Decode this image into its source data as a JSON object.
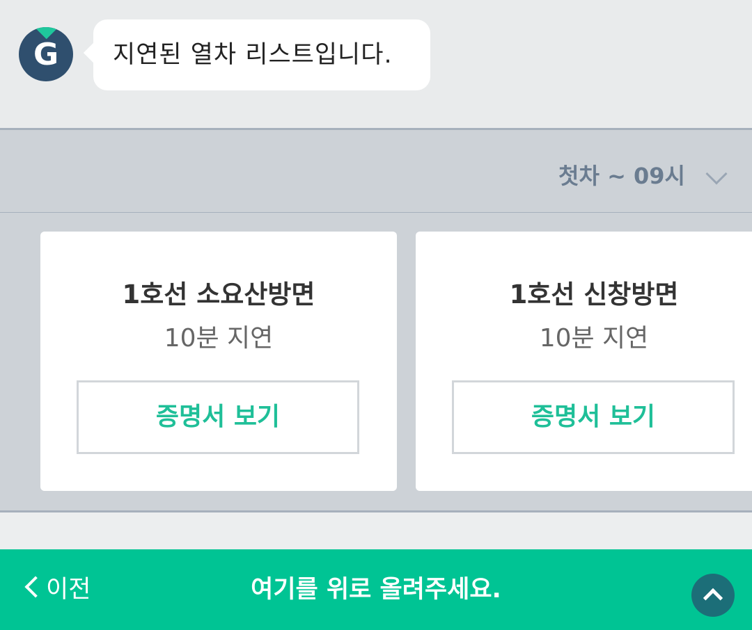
{
  "chat": {
    "avatar_letter": "G",
    "message": "지연된 열차 리스트입니다."
  },
  "filter": {
    "label": "첫차 ~ 09시"
  },
  "cards": [
    {
      "title": "1호선 소요산방면",
      "delay": "10분 지연",
      "button_label": "증명서 보기"
    },
    {
      "title": "1호선 신창방면",
      "delay": "10분 지연",
      "button_label": "증명서 보기"
    }
  ],
  "footer": {
    "prev_label": "이전",
    "hint": "여기를 위로 올려주세요."
  },
  "colors": {
    "accent": "#00c494",
    "button_text": "#1fbf98",
    "avatar_bg": "#2f4f6e",
    "up_button_bg": "#1c6e78",
    "filter_text": "#6a7c90"
  },
  "icons": [
    "g-logo-icon",
    "chevron-down-icon",
    "chevron-left-icon",
    "chevron-up-icon"
  ]
}
